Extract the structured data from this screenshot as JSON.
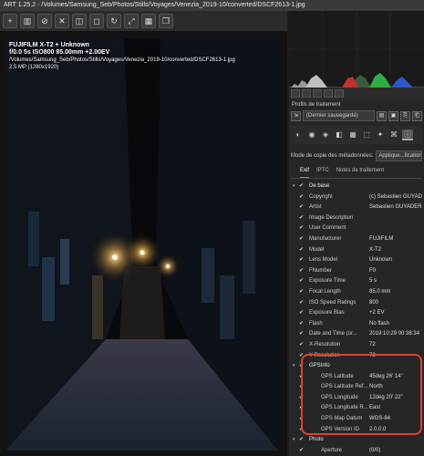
{
  "window": {
    "title": "ART 1.25.2 - /Volumes/Samsung_Seb/Photos/Stills/Voyages/Venezia_2019-10/converted/DSCF2613-1.jpg"
  },
  "toolbar": {
    "buttons": [
      "+",
      "▥",
      "⊘",
      "✕",
      "◫",
      "◻",
      "↻",
      "⤢",
      "▦",
      "❐"
    ]
  },
  "photo_overlay": {
    "line1": "FUJIFILM X-T2 + Unknown",
    "line2": "f/0.0  5s  ISO800  85.00mm  +2.00EV",
    "line3": "/Volumes/Samsung_Seb/Photos/Stills/Voyages/Venezia_2019-10/converted/DSCF2613-1.jpg",
    "line4": "2.5 MP (1280x1920)"
  },
  "profiles": {
    "title": "Profils de traitement",
    "selected": "(Dernier sauvegardé)"
  },
  "copy_mode": {
    "label": "Mode de copie des métadonnées:",
    "value": "Applique...fications"
  },
  "tabs": [
    "Exif",
    "IPTC",
    "Notes de traitement"
  ],
  "exif": [
    {
      "group": true,
      "key": "De base",
      "value": ""
    },
    {
      "key": "Copyright",
      "value": "(c) Sebastien GUYADER..."
    },
    {
      "key": "Artist",
      "value": "Sebastien GUYADER ..."
    },
    {
      "key": "Image Description",
      "value": ""
    },
    {
      "key": "User Comment",
      "value": ""
    },
    {
      "key": "Manufacturer",
      "value": "FUJIFILM"
    },
    {
      "key": "Model",
      "value": "X-T2"
    },
    {
      "key": "Lens Model",
      "value": "Unknown"
    },
    {
      "key": "FNumber",
      "value": "F0"
    },
    {
      "key": "Exposure Time",
      "value": "5 s"
    },
    {
      "key": "Focal Length",
      "value": "85.0 mm"
    },
    {
      "key": "ISO Speed Ratings",
      "value": "800"
    },
    {
      "key": "Exposure Bias",
      "value": "+2 EV"
    },
    {
      "key": "Flash",
      "value": "No flash"
    },
    {
      "key": "Date and Time (or...",
      "value": "2019:10:29 00:38:34"
    },
    {
      "key": "X-Resolution",
      "value": "72"
    },
    {
      "key": "Y-Resolution",
      "value": "72"
    },
    {
      "group": true,
      "key": "GPSInfo",
      "value": ""
    },
    {
      "sub": true,
      "key": "GPS Latitude",
      "value": "45deg 26' 14\""
    },
    {
      "sub": true,
      "key": "GPS Latitude Ref...",
      "value": "North"
    },
    {
      "sub": true,
      "key": "GPS Longitude",
      "value": "12deg 20' 22\""
    },
    {
      "sub": true,
      "key": "GPS Longitude R...",
      "value": "East"
    },
    {
      "sub": true,
      "key": "GPS Map Datum",
      "value": "WGS-84"
    },
    {
      "sub": true,
      "key": "GPS Version ID",
      "value": "2.0.0.0"
    },
    {
      "group": true,
      "key": "Photo",
      "value": ""
    },
    {
      "sub": true,
      "key": "Aperture",
      "value": "(0/0)"
    }
  ]
}
